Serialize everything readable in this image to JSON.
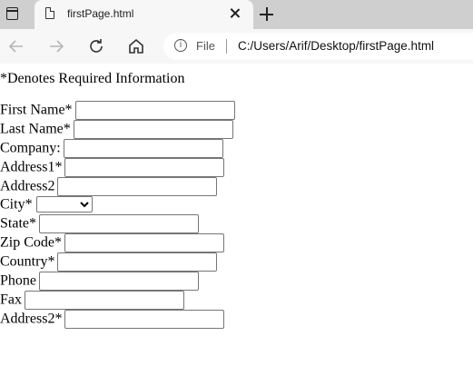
{
  "browser": {
    "tab_title": "firstPage.html",
    "address_scheme_label": "File",
    "url": "C:/Users/Arif/Desktop/firstPage.html",
    "info_icon_glyph": "i"
  },
  "page": {
    "required_note": "*Denotes Required Information",
    "fields": [
      {
        "label": "First Name*",
        "type": "text",
        "value": ""
      },
      {
        "label": "Last Name*",
        "type": "text",
        "value": ""
      },
      {
        "label": "Company:",
        "type": "text",
        "value": ""
      },
      {
        "label": "Address1*",
        "type": "text",
        "value": ""
      },
      {
        "label": "Address2",
        "type": "text",
        "value": ""
      },
      {
        "label": "City*",
        "type": "select",
        "value": ""
      },
      {
        "label": "State*",
        "type": "text",
        "value": ""
      },
      {
        "label": "Zip Code*",
        "type": "text",
        "value": ""
      },
      {
        "label": "Country*",
        "type": "text",
        "value": ""
      },
      {
        "label": "Phone",
        "type": "text",
        "value": ""
      },
      {
        "label": "Fax",
        "type": "text",
        "value": ""
      },
      {
        "label": "Address2*",
        "type": "text",
        "value": ""
      }
    ]
  }
}
